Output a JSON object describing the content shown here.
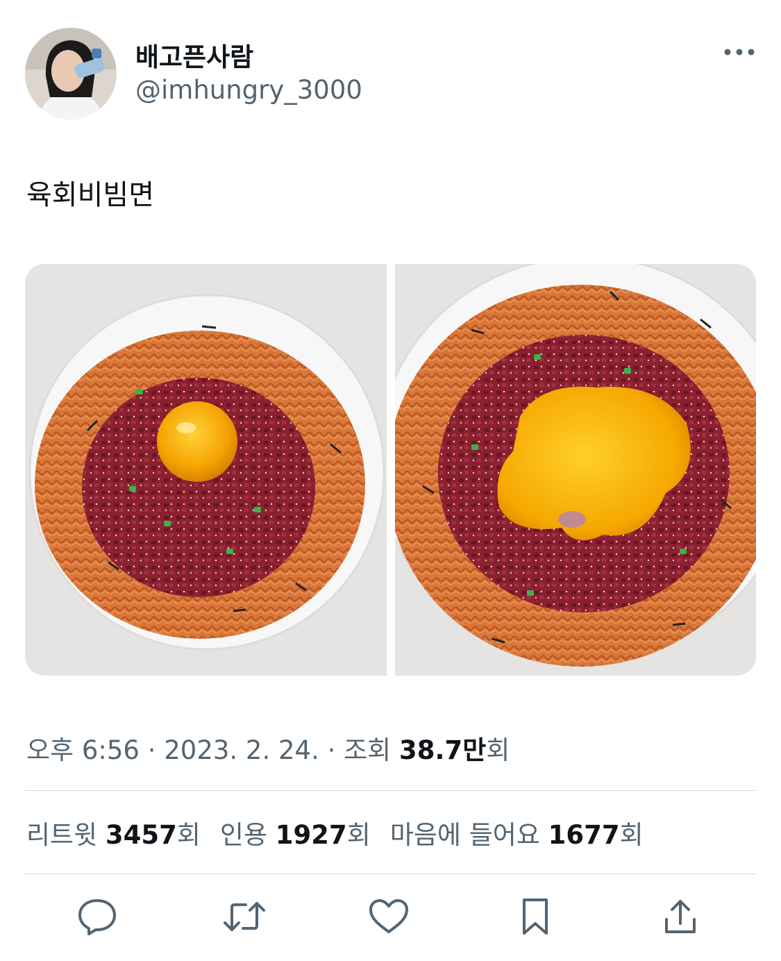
{
  "author": {
    "display_name": "배고픈사람",
    "handle": "@imhungry_3000"
  },
  "tweet": {
    "text": "육회비빔면"
  },
  "media": {
    "photos": [
      {
        "label": "photo-1"
      },
      {
        "label": "photo-2"
      }
    ]
  },
  "meta": {
    "time": "오후 6:56",
    "date": "2023. 2. 24.",
    "views_label": "조회",
    "views_count": "38.7만",
    "views_suffix": "회",
    "separator": "·"
  },
  "stats": {
    "retweets_label": "리트윗",
    "retweets_count": "3457",
    "quotes_label": "인용",
    "quotes_count": "1927",
    "likes_label": "마음에 들어요",
    "likes_count": "1677",
    "count_suffix": "회"
  },
  "actions": {
    "icons": [
      "reply-icon",
      "retweet-icon",
      "like-icon",
      "bookmark-icon",
      "share-icon"
    ]
  },
  "colors": {
    "text_primary": "#0f1419",
    "text_secondary": "#536471",
    "divider": "#cfd9de"
  }
}
